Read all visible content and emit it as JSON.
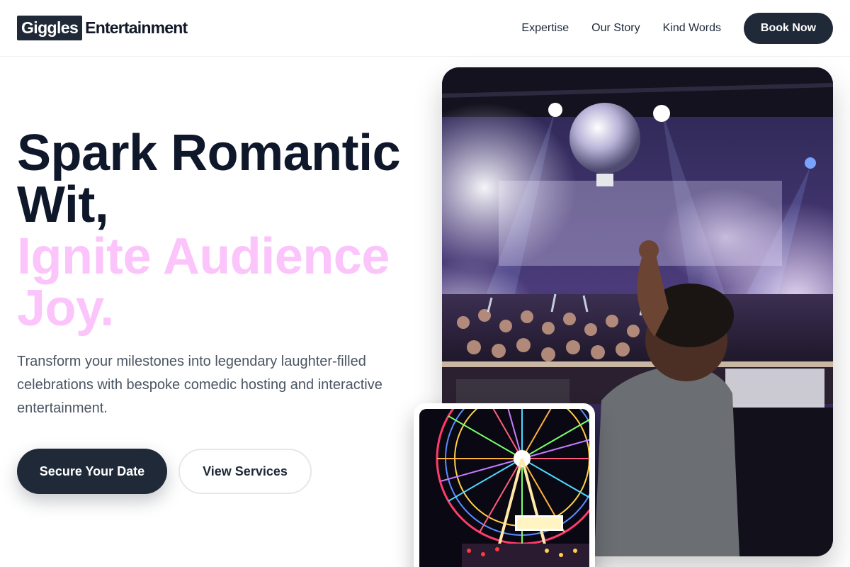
{
  "brand": {
    "box": "Giggles",
    "text": "Entertainment"
  },
  "nav": {
    "links": [
      "Expertise",
      "Our Story",
      "Kind Words"
    ],
    "cta": "Book Now"
  },
  "hero": {
    "line1": "Spark Romantic",
    "line2": "Wit,",
    "line3": "Ignite Audience",
    "line4": "Joy.",
    "subtext": "Transform your milestones into legendary laughter-filled celebrations with bespoke comedic hosting and interactive entertainment.",
    "primary_cta": "Secure Your Date",
    "secondary_cta": "View Services"
  },
  "colors": {
    "dark": "#1f2937",
    "headline_dark": "#0f172a",
    "accent_pink": "#fbc4fb",
    "body_gray": "#4b5563"
  },
  "images": {
    "main": "dj-nightclub-crowd-photo",
    "thumb": "ferris-wheel-night-photo"
  }
}
